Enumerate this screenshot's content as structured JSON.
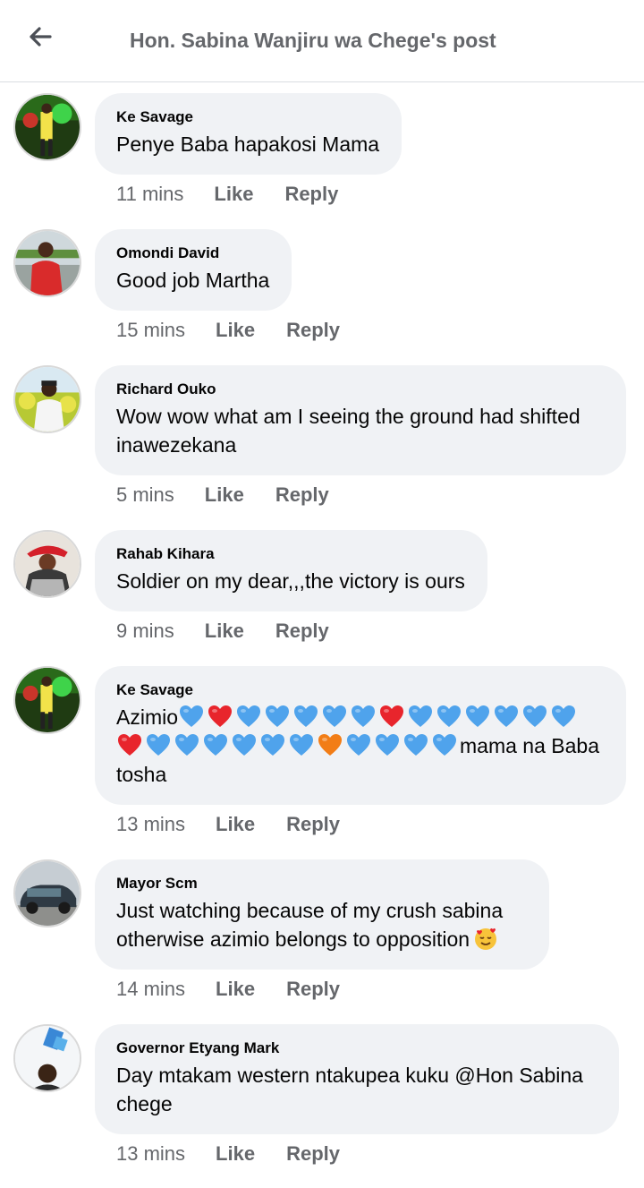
{
  "header": {
    "title": "Hon. Sabina Wanjiru wa Chege's post"
  },
  "actions": {
    "like": "Like",
    "reply": "Reply"
  },
  "comments": [
    {
      "author": "Ke Savage",
      "text": "Penye Baba hapakosi Mama",
      "time": "11 mins"
    },
    {
      "author": "Omondi David",
      "text": "Good job Martha",
      "time": "15 mins"
    },
    {
      "author": "Richard Ouko",
      "text": "Wow wow what am I seeing the ground had shifted inawezekana",
      "time": "5 mins"
    },
    {
      "author": "Rahab Kihara",
      "text": "Soldier on my dear,,,the victory is ours",
      "time": "9 mins"
    },
    {
      "author": "Ke Savage",
      "text_start": "Azimio",
      "text_end": "mama na Baba tosha",
      "time": "13 mins",
      "hearts": [
        "blue",
        "red",
        "blue",
        "blue",
        "blue",
        "blue",
        "blue",
        "red",
        "blue",
        "blue",
        "blue",
        "blue",
        "blue",
        "blue",
        "red",
        "blue",
        "blue",
        "blue",
        "blue",
        "blue",
        "blue",
        "orange",
        "blue",
        "blue",
        "blue",
        "blue"
      ]
    },
    {
      "author": "Mayor Scm",
      "text": "Just watching because of my crush sabina otherwise azimio belongs to opposition",
      "time": "14 mins",
      "emoji": "hearts-smiling-face"
    },
    {
      "author": "Governor Etyang Mark",
      "text": "Day mtakam western ntakupea kuku @Hon Sabina chege",
      "time": "13 mins"
    }
  ],
  "colors": {
    "blue_heart": "#4fa3ec",
    "red_heart": "#e8252c",
    "orange_heart": "#f27d16",
    "meta_text": "#65676b",
    "bubble": "#f0f2f5"
  }
}
